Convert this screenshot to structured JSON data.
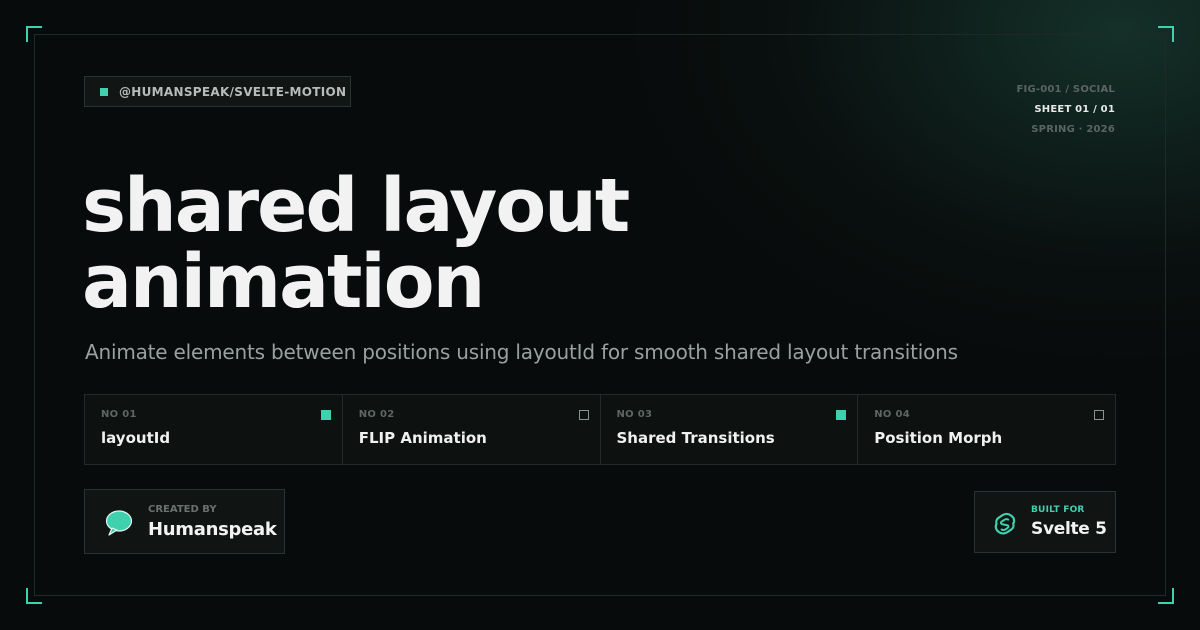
{
  "package": {
    "icon": "square-icon",
    "label": "@HUMANSPEAK/SVELTE-MOTION"
  },
  "meta": {
    "figure": "FIG-001 / SOCIAL",
    "sheet": "SHEET 01 / 01",
    "season": "SPRING · 2026"
  },
  "title": {
    "line1": "shared layout",
    "line2": "animation"
  },
  "subtitle": "Animate elements between positions using layoutId for smooth shared layout transitions",
  "features": [
    {
      "no": "NO 01",
      "name": "layoutId",
      "checked": true
    },
    {
      "no": "NO 02",
      "name": "FLIP Animation",
      "checked": false
    },
    {
      "no": "NO 03",
      "name": "Shared Transitions",
      "checked": true
    },
    {
      "no": "NO 04",
      "name": "Position Morph",
      "checked": false
    }
  ],
  "created": {
    "label": "CREATED BY",
    "name": "Humanspeak",
    "icon": "speech-bubble-icon"
  },
  "built": {
    "label": "BUILT FOR",
    "framework": "Svelte 5",
    "icon": "svelte-logo-icon"
  },
  "colors": {
    "accent": "#3fd1ae",
    "background": "#080b0b",
    "text": "#f2f2f2",
    "muted": "#9aa09f"
  }
}
